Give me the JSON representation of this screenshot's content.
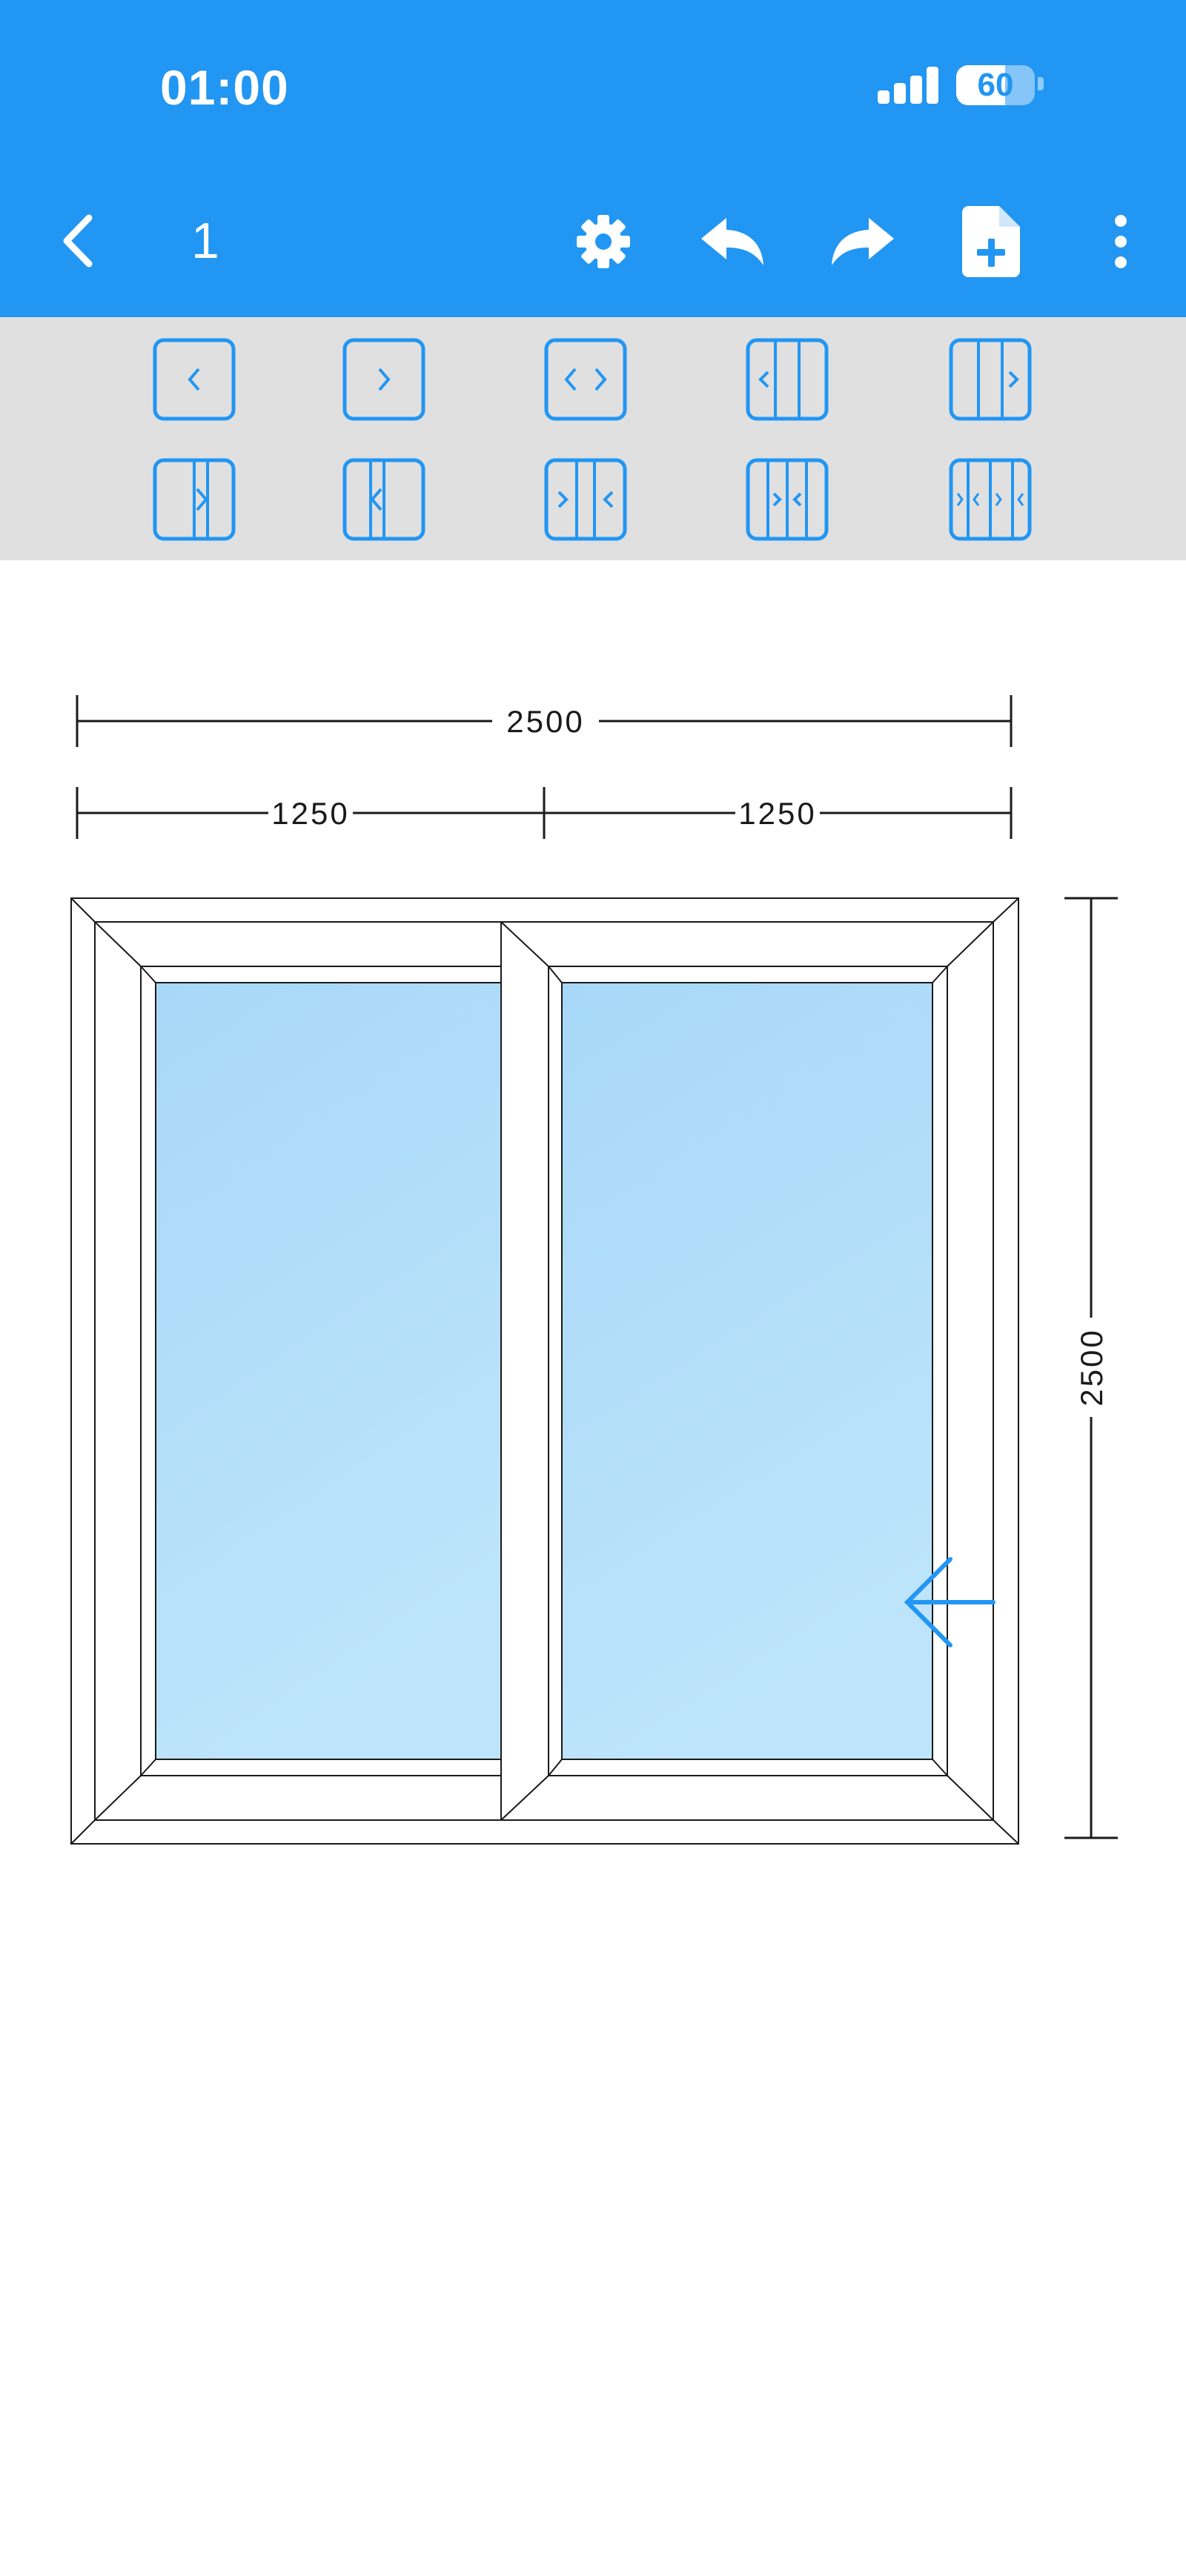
{
  "status_bar": {
    "time": "01:00",
    "battery": "60"
  },
  "toolbar": {
    "back_icon": "chevron-left-icon",
    "document_number": "1",
    "actions": [
      {
        "icon": "gear-icon"
      },
      {
        "icon": "undo-icon"
      },
      {
        "icon": "redo-icon"
      },
      {
        "icon": "file-add-icon"
      },
      {
        "icon": "more-vertical-icon"
      }
    ]
  },
  "opening_types": [
    {
      "icon": "single-sash-open-left-icon"
    },
    {
      "icon": "single-sash-open-right-icon"
    },
    {
      "icon": "single-sash-open-both-icon"
    },
    {
      "icon": "two-pane-left-open-icon"
    },
    {
      "icon": "two-pane-right-open-icon"
    },
    {
      "icon": "two-pane-slide-right-icon"
    },
    {
      "icon": "two-pane-slide-left-icon"
    },
    {
      "icon": "two-pane-slide-apart-icon"
    },
    {
      "icon": "three-pane-slide-icon"
    },
    {
      "icon": "four-pane-slide-icon"
    }
  ],
  "drawing": {
    "overall_width": "2500",
    "section_widths": [
      "1250",
      "1250"
    ],
    "height": "2500",
    "slide_arrow_icon": "arrow-left-icon"
  },
  "colors": {
    "primary": "#2196F3",
    "panel": "#E0E0E0",
    "glass_top": "#A8D8F8",
    "glass_bottom": "#BDE4FA",
    "line": "#1A1A1A"
  }
}
